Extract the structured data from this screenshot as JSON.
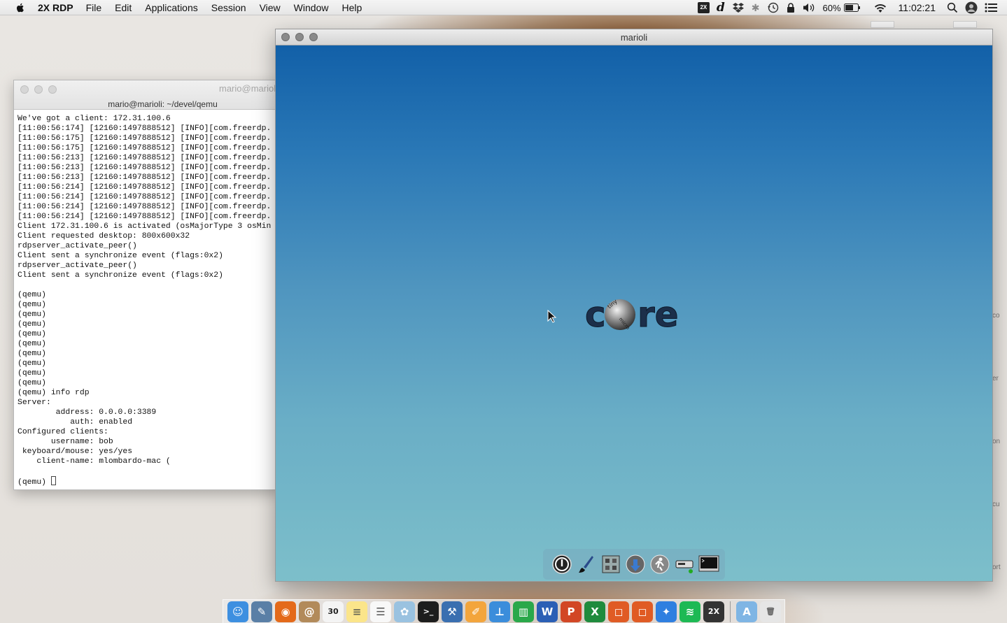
{
  "menubar": {
    "app_name": "2X RDP",
    "items": [
      "File",
      "Edit",
      "Applications",
      "Session",
      "View",
      "Window",
      "Help"
    ],
    "battery": "60%",
    "clock": "11:02:21"
  },
  "terminal": {
    "window_title": "mario@marioli",
    "tab_title": "mario@marioli: ~/devel/qemu",
    "lines": [
      "We've got a client: 172.31.100.6",
      "[11:00:56:174] [12160:1497888512] [INFO][com.freerdp.",
      "[11:00:56:175] [12160:1497888512] [INFO][com.freerdp.",
      "[11:00:56:175] [12160:1497888512] [INFO][com.freerdp.",
      "[11:00:56:213] [12160:1497888512] [INFO][com.freerdp.",
      "[11:00:56:213] [12160:1497888512] [INFO][com.freerdp.",
      "[11:00:56:213] [12160:1497888512] [INFO][com.freerdp.",
      "[11:00:56:214] [12160:1497888512] [INFO][com.freerdp.",
      "[11:00:56:214] [12160:1497888512] [INFO][com.freerdp.",
      "[11:00:56:214] [12160:1497888512] [INFO][com.freerdp.",
      "[11:00:56:214] [12160:1497888512] [INFO][com.freerdp.",
      "Client 172.31.100.6 is activated (osMajorType 3 osMin",
      "Client requested desktop: 800x600x32",
      "rdpserver_activate_peer()",
      "Client sent a synchronize event (flags:0x2)",
      "rdpserver_activate_peer()",
      "Client sent a synchronize event (flags:0x2)",
      "",
      "(qemu)",
      "(qemu)",
      "(qemu)",
      "(qemu)",
      "(qemu)",
      "(qemu)",
      "(qemu)",
      "(qemu)",
      "(qemu)",
      "(qemu)",
      "(qemu) info rdp",
      "Server:",
      "        address: 0.0.0.0:3389",
      "           auth: enabled",
      "Configured clients:",
      "       username: bob",
      " keyboard/mouse: yes/yes",
      "    client-name: mlombardo-mac (",
      ""
    ],
    "prompt": "(qemu) "
  },
  "rdp": {
    "title": "marioli",
    "logo_text": "core",
    "logo_small_top": "tiny",
    "logo_small_bottom": "micro"
  },
  "wbar": {
    "icons": [
      "power-icon",
      "paint-brush-icon",
      "control-panel-icon",
      "apps-install-icon",
      "run-icon",
      "mount-tool-icon",
      "terminal-icon"
    ]
  },
  "dock": {
    "icons": [
      {
        "name": "finder-icon",
        "color": "#3d8fe0",
        "glyph": "☺"
      },
      {
        "name": "preview-icon",
        "color": "#5a7fa6",
        "glyph": "✎"
      },
      {
        "name": "firefox-icon",
        "color": "#e46a1a",
        "glyph": "◉"
      },
      {
        "name": "contacts-icon",
        "color": "#b28a5a",
        "glyph": "@"
      },
      {
        "name": "calendar-icon",
        "color": "#f4f4f4",
        "glyph": "30",
        "text_color": "#222"
      },
      {
        "name": "notes-icon",
        "color": "#fbe58a",
        "glyph": "≡",
        "text_color": "#665"
      },
      {
        "name": "reminders-icon",
        "color": "#f8f8f8",
        "glyph": "☰",
        "text_color": "#555"
      },
      {
        "name": "photos-icon",
        "color": "#9ac2e0",
        "glyph": "✿"
      },
      {
        "name": "terminal-app-icon",
        "color": "#1d1d1d",
        "glyph": ">_"
      },
      {
        "name": "xcode-icon",
        "color": "#3a6fb0",
        "glyph": "⚒"
      },
      {
        "name": "pages-icon",
        "color": "#f3a53c",
        "glyph": "✐"
      },
      {
        "name": "keynote-icon",
        "color": "#3b8ddb",
        "glyph": "⊥"
      },
      {
        "name": "numbers-icon",
        "color": "#2aa84a",
        "glyph": "▥"
      },
      {
        "name": "word-icon",
        "color": "#2b5fb5",
        "glyph": "W"
      },
      {
        "name": "powerpoint-icon",
        "color": "#d24625",
        "glyph": "P"
      },
      {
        "name": "excel-icon",
        "color": "#1f8b3d",
        "glyph": "X"
      },
      {
        "name": "office-icon-1",
        "color": "#e05b24",
        "glyph": "◻"
      },
      {
        "name": "office-icon-2",
        "color": "#e05b24",
        "glyph": "◻"
      },
      {
        "name": "safari-icon",
        "color": "#2f7fe0",
        "glyph": "✦"
      },
      {
        "name": "spotify-icon",
        "color": "#1db954",
        "glyph": "≋"
      },
      {
        "name": "2x-rdp-icon",
        "color": "#333333",
        "glyph": "2X"
      },
      {
        "name": "applications-folder-icon",
        "color": "#7fb5e4",
        "glyph": "A"
      },
      {
        "name": "trash-icon",
        "color": "#e6e6e6",
        "glyph": "🗑",
        "text_color": "#666"
      }
    ]
  },
  "edge_labels": [
    "co",
    "er",
    "on",
    "cu",
    "ort"
  ]
}
